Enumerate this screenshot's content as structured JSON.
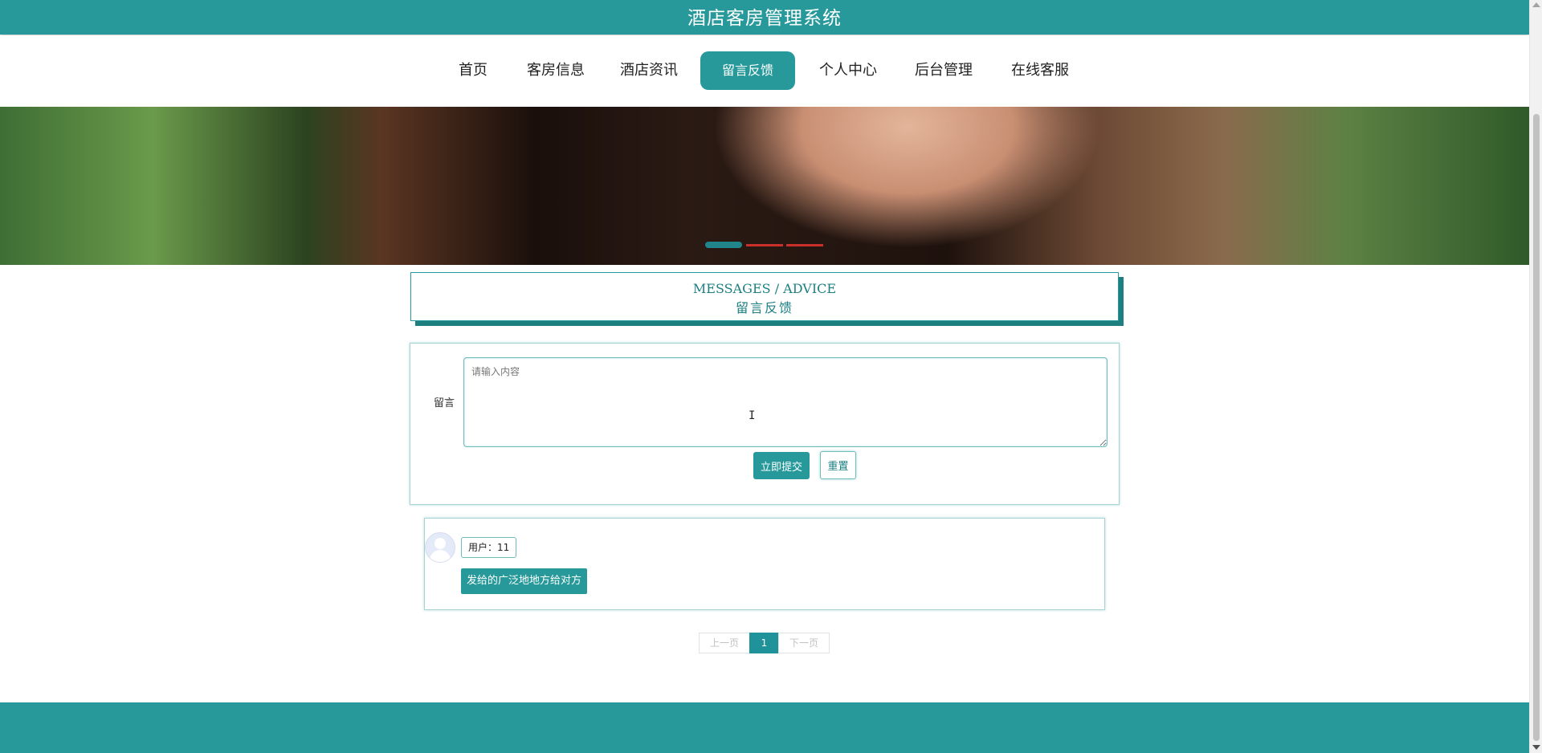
{
  "header": {
    "title": "酒店客房管理系统"
  },
  "nav": {
    "items": [
      {
        "label": "首页"
      },
      {
        "label": "客房信息"
      },
      {
        "label": "酒店资讯"
      },
      {
        "label": "留言反馈",
        "active": true
      },
      {
        "label": "个人中心"
      },
      {
        "label": "后台管理"
      },
      {
        "label": "在线客服"
      }
    ]
  },
  "banner": {
    "slide_count": 3,
    "active_slide": 1
  },
  "section": {
    "title_en": "MESSAGES / ADVICE",
    "title_cn": "留言反馈"
  },
  "form": {
    "label": "留言",
    "placeholder": "请输入内容",
    "value": "",
    "submit_label": "立即提交",
    "reset_label": "重置"
  },
  "messages": [
    {
      "user": "用户：11",
      "content": "发给的广泛地地方给对方"
    }
  ],
  "pagination": {
    "prev_label": "上一页",
    "current": "1",
    "next_label": "下一页"
  },
  "colors": {
    "primary": "#27999a",
    "primary_dark": "#1d7f80",
    "dot_inactive": "#c9302c"
  }
}
